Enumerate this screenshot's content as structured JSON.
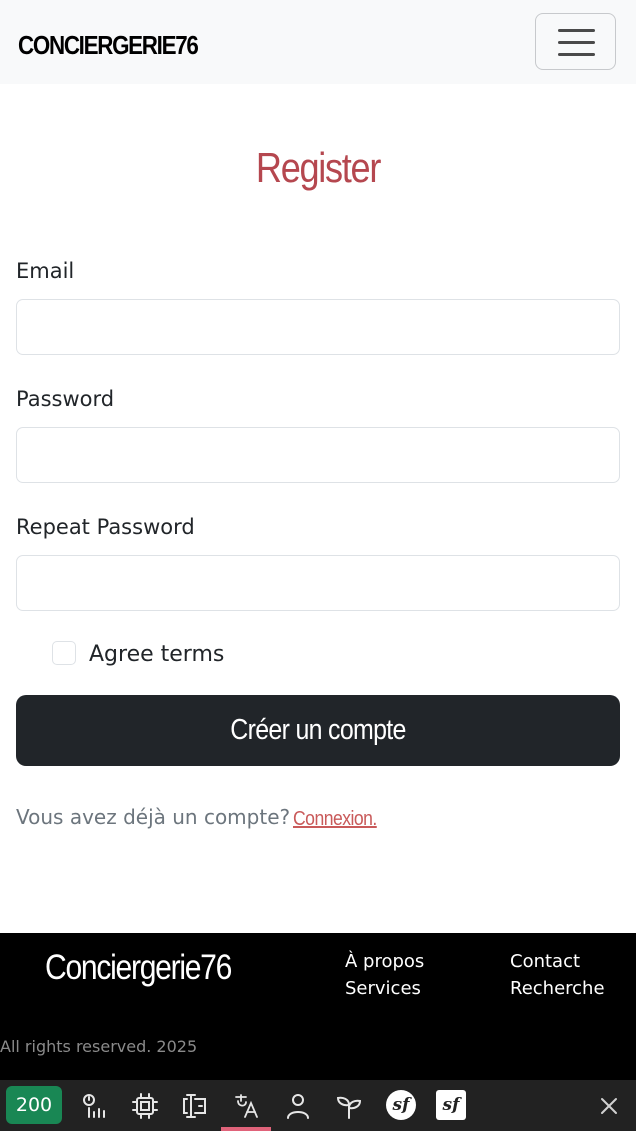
{
  "navbar": {
    "brand": "CONCIERGERIE76",
    "toggle_icon": "hamburger-menu-icon"
  },
  "form": {
    "title": "Register",
    "email_label": "Email",
    "email_value": "",
    "password_label": "Password",
    "password_value": "",
    "repeat_password_label": "Repeat Password",
    "repeat_password_value": "",
    "agree_terms_label": "Agree terms",
    "agree_terms_checked": false,
    "submit_label": "Créer un compte",
    "already_text": "Vous avez déjà un compte?",
    "login_link": "Connexion."
  },
  "footer": {
    "brand": "Conciergerie76",
    "links": [
      "À propos",
      "Services",
      "Contact",
      "Recherche"
    ],
    "copyright": "All rights reserved. 2025"
  },
  "debug_toolbar": {
    "status_code": "200",
    "icons": [
      "performance-icon",
      "memory-icon",
      "forms-icon",
      "translation-icon",
      "user-icon",
      "events-icon",
      "symfony-icon",
      "symfony-logo-icon",
      "close-icon"
    ]
  },
  "colors": {
    "accent": "#b5474f",
    "link": "#c95a5a",
    "button_bg": "#212529",
    "status_ok": "#198754",
    "toolbar_bg": "#222222",
    "active_tab": "#e0637a"
  }
}
